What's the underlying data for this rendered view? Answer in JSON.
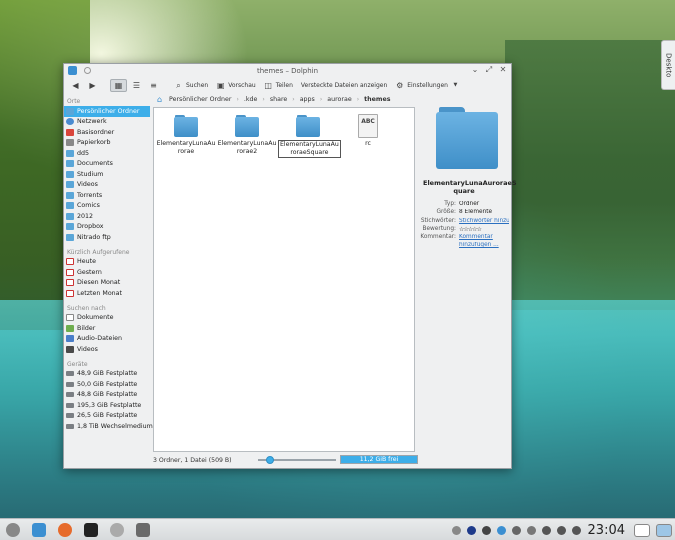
{
  "desktop": {
    "widget_tab": "Deskto"
  },
  "window": {
    "title": "themes – Dolphin",
    "buttons": {
      "minimize": "⌄",
      "maximize": "⤢",
      "close": "✕"
    }
  },
  "toolbar": {
    "back": "◀",
    "forward": "▶",
    "search": "Suchen",
    "preview": "Vorschau",
    "split": "Teilen",
    "hidden": "Versteckte Dateien anzeigen",
    "settings": "Einstellungen"
  },
  "sidebar": {
    "places_title": "Orte",
    "places": [
      {
        "label": "Persönlicher Ordner",
        "icon": "home-folder-icon"
      },
      {
        "label": "Netzwerk",
        "icon": "network-icon"
      },
      {
        "label": "Basisordner",
        "icon": "root-folder-icon"
      },
      {
        "label": "Papierkorb",
        "icon": "trash-icon"
      },
      {
        "label": "dd5",
        "icon": "folder-icon"
      },
      {
        "label": "Documents",
        "icon": "folder-icon"
      },
      {
        "label": "Studium",
        "icon": "folder-icon"
      },
      {
        "label": "Videos",
        "icon": "folder-icon"
      },
      {
        "label": "Torrents",
        "icon": "folder-icon"
      },
      {
        "label": "Comics",
        "icon": "folder-icon"
      },
      {
        "label": "2012",
        "icon": "folder-icon"
      },
      {
        "label": "Dropbox",
        "icon": "folder-icon"
      },
      {
        "label": "Nitrado ftp",
        "icon": "folder-icon"
      }
    ],
    "recent_title": "Kürzlich Aufgerufene",
    "recent": [
      {
        "label": "Heute"
      },
      {
        "label": "Gestern"
      },
      {
        "label": "Diesen Monat"
      },
      {
        "label": "Letzten Monat"
      }
    ],
    "search_title": "Suchen nach",
    "search": [
      {
        "label": "Dokumente"
      },
      {
        "label": "Bilder"
      },
      {
        "label": "Audio-Dateien"
      },
      {
        "label": "Videos"
      }
    ],
    "devices_title": "Geräte",
    "devices": [
      {
        "label": "48,9 GiB Festplatte"
      },
      {
        "label": "50,0 GiB Festplatte"
      },
      {
        "label": "48,8 GiB Festplatte"
      },
      {
        "label": "195,3 GiB Festplatte"
      },
      {
        "label": "26,5 GiB Festplatte"
      },
      {
        "label": "1,8 TiB Wechselmedium"
      }
    ]
  },
  "breadcrumb": [
    "Persönlicher Ordner",
    ".kde",
    "share",
    "apps",
    "aurorae",
    "themes"
  ],
  "files": [
    {
      "name1": "ElementaryLunaAu",
      "name2": "rorae",
      "type": "folder"
    },
    {
      "name1": "ElementaryLunaAu",
      "name2": "rorae2",
      "type": "folder"
    },
    {
      "name1": "ElementaryLunaAu",
      "name2": "roraeSquare",
      "type": "folder"
    },
    {
      "name1": "rc",
      "name2": "",
      "type": "doc",
      "badge": "ABC"
    }
  ],
  "status": {
    "summary": "3 Ordner, 1 Datei (509 B)",
    "zoom_level": 0.15,
    "free_label": "11,2 GiB frei",
    "used_fraction": 1.0
  },
  "info": {
    "name1": "ElementaryLunaAuroraeS",
    "name2": "quare",
    "rows": [
      {
        "k": "Typ:",
        "v": "Ordner"
      },
      {
        "k": "Größe:",
        "v": "8 Elemente"
      },
      {
        "k": "Stichwörter:",
        "v": "Stichwörter hinzufü",
        "link": true
      },
      {
        "k": "Bewertung:",
        "v": "☆☆☆☆☆"
      },
      {
        "k": "Kommentar:",
        "v": "Kommentar",
        "link": true
      },
      {
        "k": "",
        "v": "hinzufügen ...",
        "link": true
      }
    ]
  },
  "taskbar": {
    "clock": "23:04"
  }
}
